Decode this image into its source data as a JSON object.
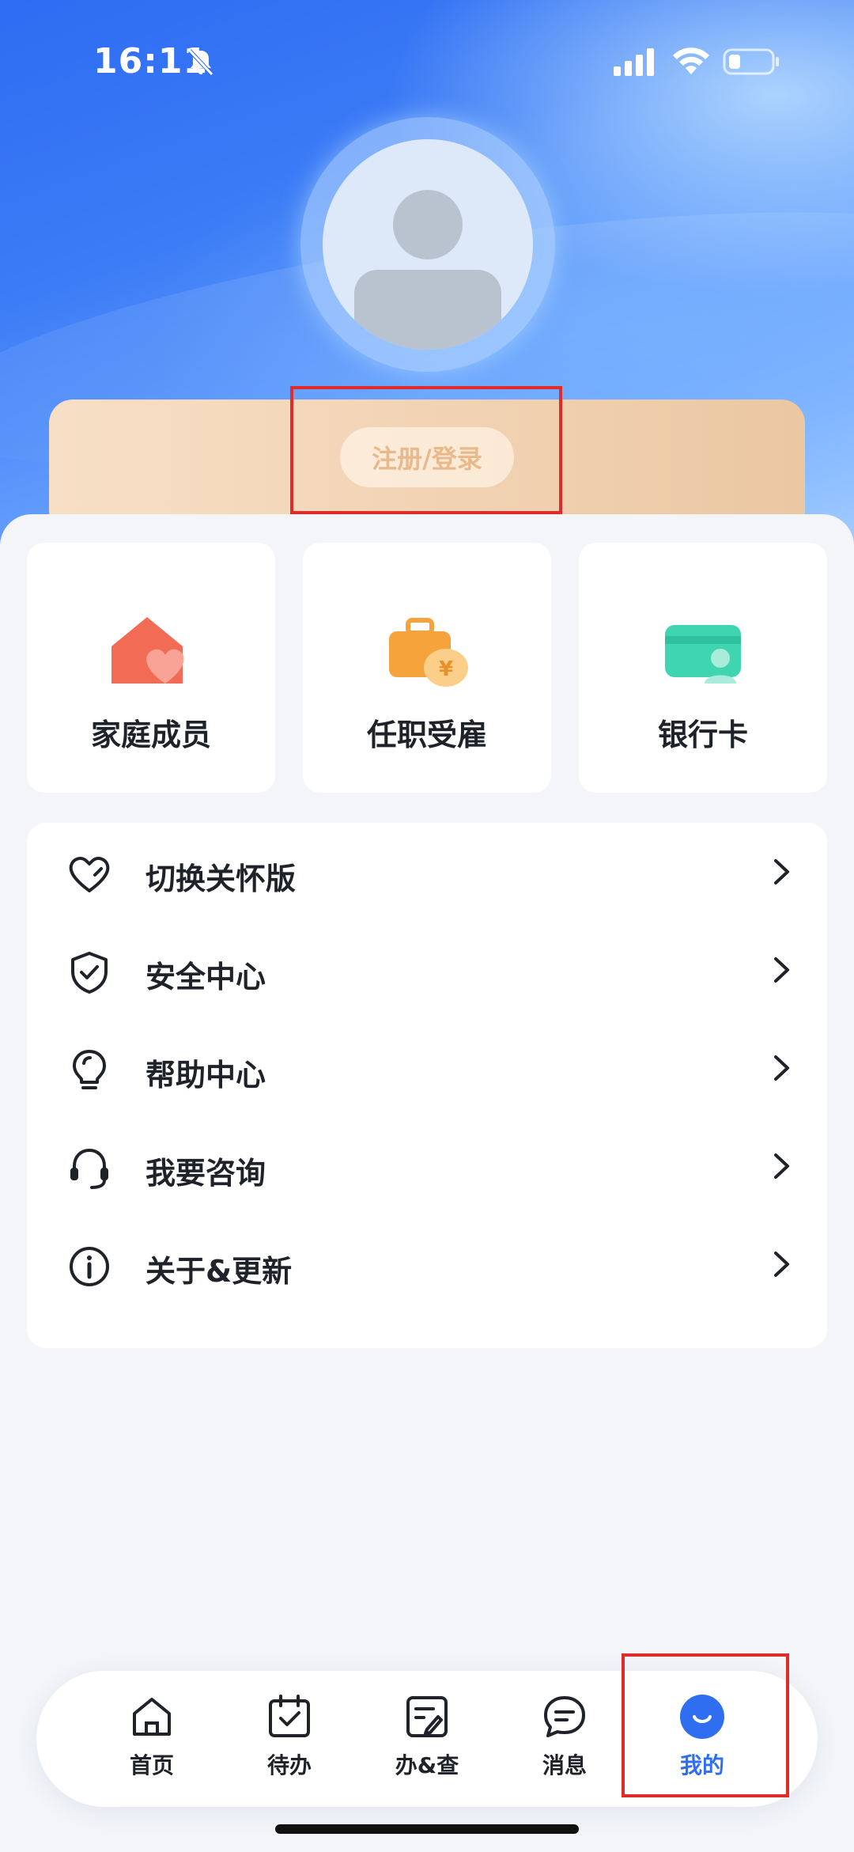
{
  "status_bar": {
    "time": "16:11"
  },
  "profile": {
    "login_label": "注册/登录"
  },
  "quick_actions": [
    {
      "label": "家庭成员",
      "icon": "house-heart-icon",
      "color": "#f26b55"
    },
    {
      "label": "任职受雇",
      "icon": "briefcase-money-icon",
      "color": "#f5a33a"
    },
    {
      "label": "银行卡",
      "icon": "bank-card-icon",
      "color": "#3fd5b0"
    }
  ],
  "menu": [
    {
      "label": "切换关怀版",
      "icon": "heart-icon"
    },
    {
      "label": "安全中心",
      "icon": "shield-check-icon"
    },
    {
      "label": "帮助中心",
      "icon": "lightbulb-icon"
    },
    {
      "label": "我要咨询",
      "icon": "headset-icon"
    },
    {
      "label": "关于&更新",
      "icon": "info-icon"
    }
  ],
  "tabbar": {
    "items": [
      {
        "label": "首页",
        "icon": "home-icon"
      },
      {
        "label": "待办",
        "icon": "calendar-check-icon"
      },
      {
        "label": "办&查",
        "icon": "document-edit-icon"
      },
      {
        "label": "消息",
        "icon": "chat-bubble-icon"
      },
      {
        "label": "我的",
        "icon": "smile-user-icon",
        "active": true
      }
    ],
    "active_color": "#2f6ef0"
  }
}
